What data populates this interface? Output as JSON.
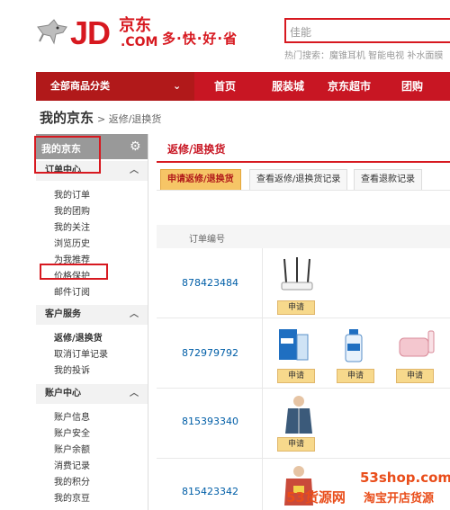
{
  "header": {
    "logo_text": "JD",
    "logo_cn": "京东",
    "logo_com": ".COM",
    "slogan": "多·快·好·省",
    "search_placeholder": "佳能",
    "hot_search": "热门搜索：魔锥耳机  智能电视  补水面膜"
  },
  "nav": {
    "category_label": "全部商品分类",
    "items": [
      "首页",
      "服装城",
      "京东超市",
      "团购"
    ]
  },
  "breadcrumb": {
    "main": "我的京东",
    "sub": "> 返修/退换货"
  },
  "sidebar": {
    "title": "我的京东",
    "sections": [
      {
        "title": "订单中心",
        "items": [
          "我的订单",
          "我的团购",
          "我的关注",
          "浏览历史",
          "为我推荐",
          "价格保护",
          "邮件订阅"
        ]
      },
      {
        "title": "客户服务",
        "items": [
          "返修/退换货",
          "取消订单记录",
          "我的投诉"
        ]
      },
      {
        "title": "账户中心",
        "items": [
          "账户信息",
          "账户安全",
          "账户余额",
          "消费记录",
          "我的积分",
          "我的京豆"
        ]
      }
    ]
  },
  "main": {
    "title": "返修/退换货",
    "tabs": [
      "申请返修/退换货",
      "查看返修/退换货记录",
      "查看退款记录"
    ],
    "column_header": "订单编号",
    "apply_label": "申请",
    "orders": [
      {
        "id": "878423484",
        "products": [
          "router"
        ]
      },
      {
        "id": "872979792",
        "products": [
          "lens-solution-box",
          "lens-solution-bottle",
          "lens-case-pink"
        ]
      },
      {
        "id": "815393340",
        "products": [
          "mens-jacket"
        ]
      },
      {
        "id": "815423342",
        "products": [
          "tshirt"
        ]
      }
    ]
  },
  "watermark": {
    "url": "53shop.com",
    "brand": "53货源网",
    "tagline": "淘宝开店货源"
  },
  "colors": {
    "jd_red": "#d71920",
    "nav_red": "#c81623",
    "link_blue": "#005ea7",
    "tab_active": "#f6c566",
    "watermark": "#e94d1a"
  }
}
